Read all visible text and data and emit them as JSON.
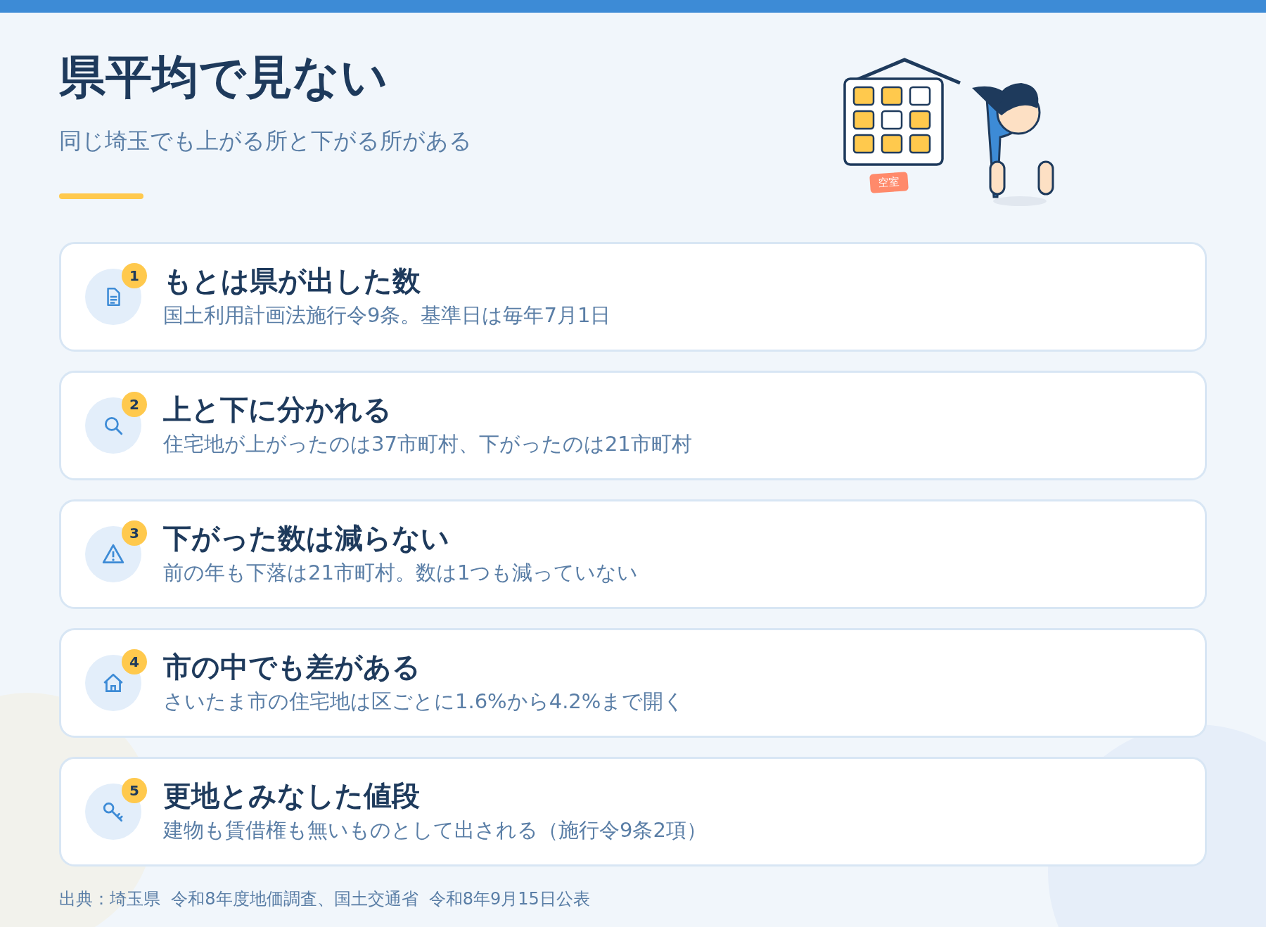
{
  "header": {
    "title": "県平均で見ない",
    "subtitle": "同じ埼玉でも上がる所と下がる所がある"
  },
  "illustration": {
    "tag": "空室",
    "windows": [
      {
        "occupied": true
      },
      {
        "occupied": true
      },
      {
        "occupied": false
      },
      {
        "occupied": true
      },
      {
        "occupied": false
      },
      {
        "occupied": true
      },
      {
        "occupied": true
      },
      {
        "occupied": true
      },
      {
        "occupied": true
      }
    ]
  },
  "points": [
    {
      "number": "1",
      "title": "もとは県が出した数",
      "text": "国土利用計画法施行令9条。基準日は毎年7月1日"
    },
    {
      "number": "2",
      "title": "上と下に分かれる",
      "text": "住宅地が上がったのは37市町村、下がったのは21市町村"
    },
    {
      "number": "3",
      "title": "下がった数は減らない",
      "text": "前の年も下落は21市町村。数は1つも減っていない"
    },
    {
      "number": "4",
      "title": "市の中でも差がある",
      "text": "さいたま市の住宅地は区ごとに1.6%から4.2%まで開く"
    },
    {
      "number": "5",
      "title": "更地とみなした値段",
      "text": "建物も賃借権も無いものとして出される（施行令9条2項）"
    }
  ],
  "source": "出典：埼玉県  令和8年度地価調査、国土交通省  令和8年9月15日公表"
}
